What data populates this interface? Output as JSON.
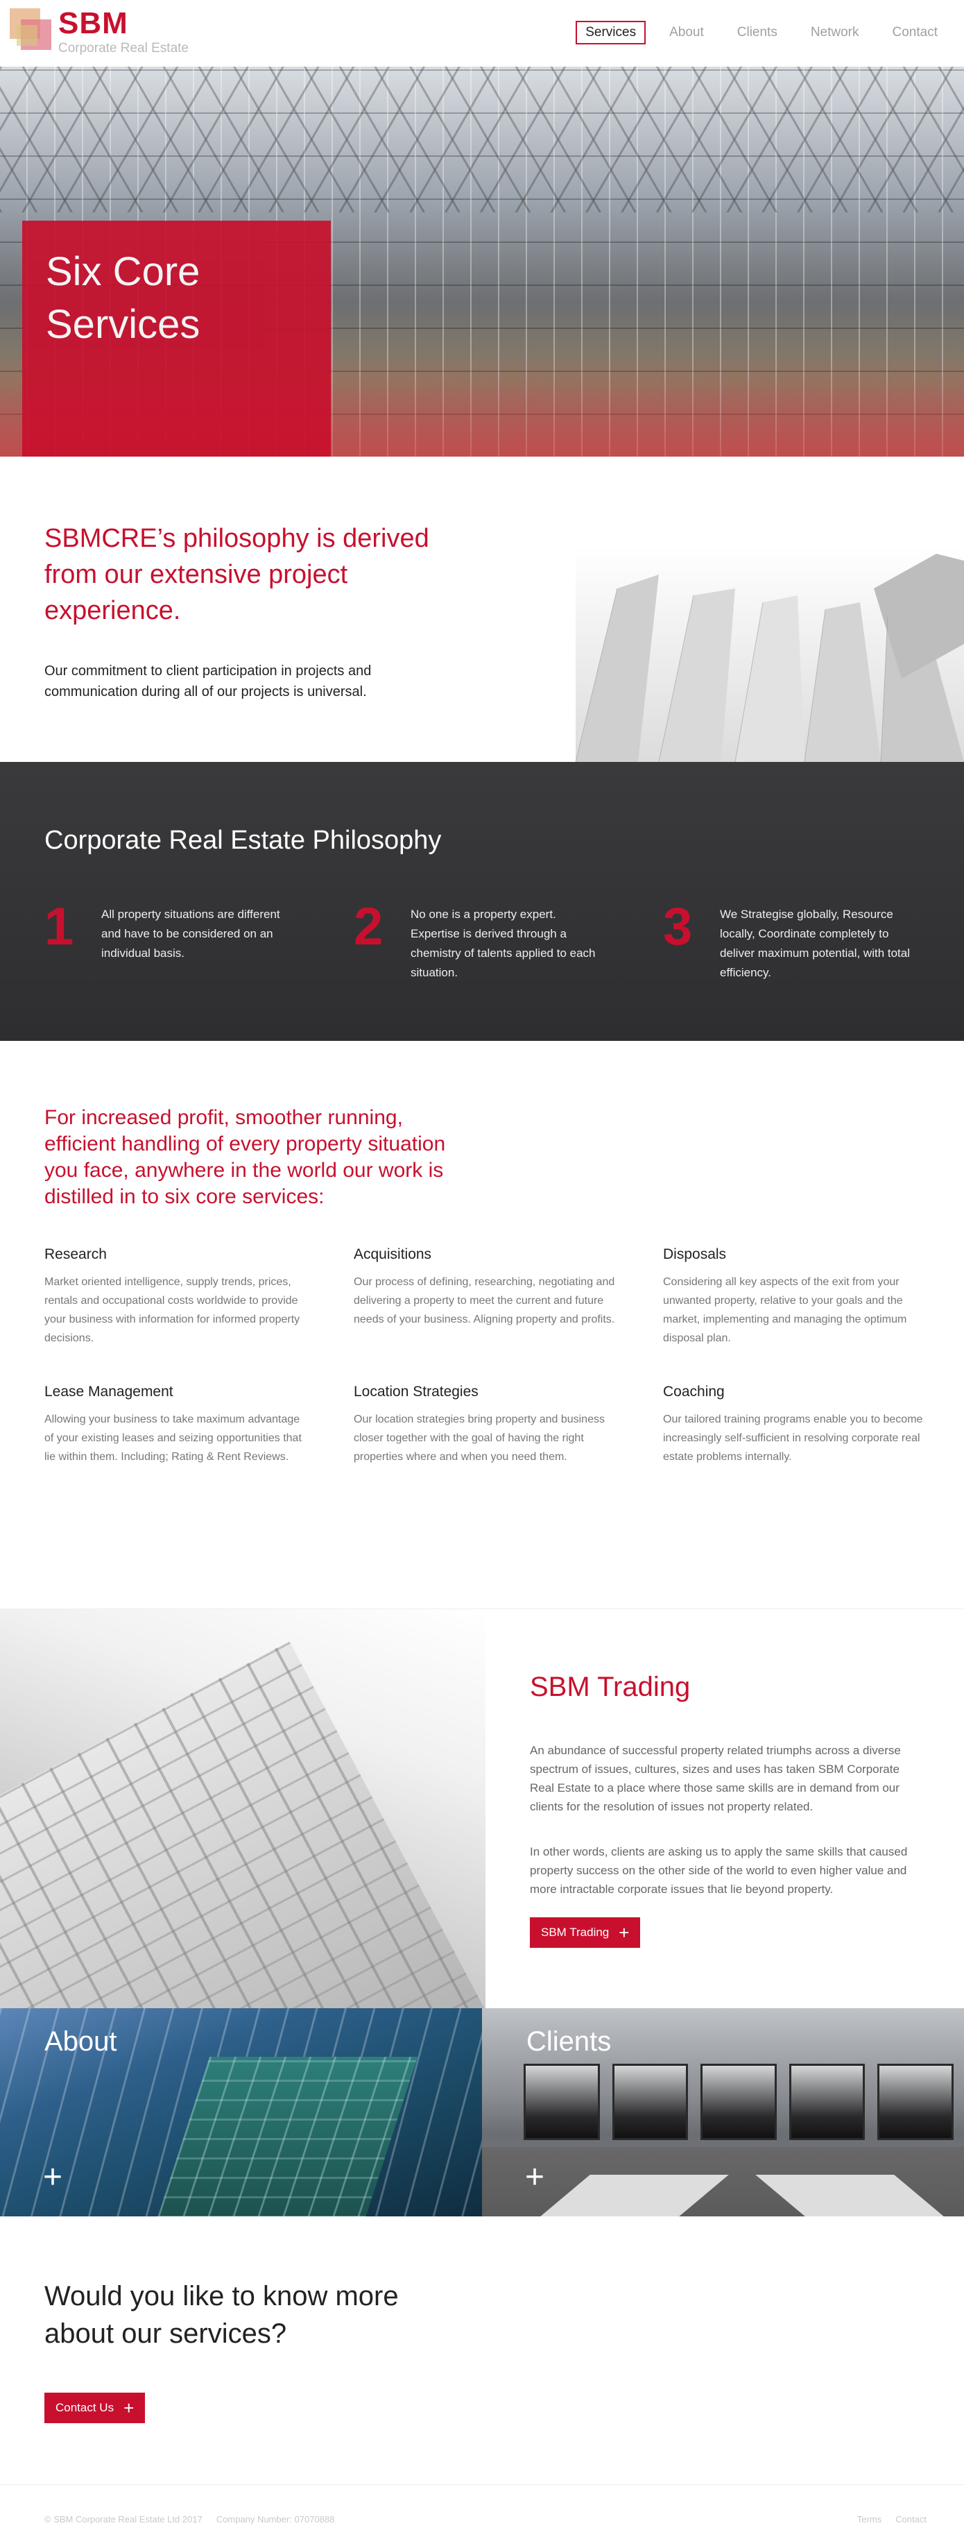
{
  "brand": {
    "name": "SBM",
    "tagline": "Corporate Real Estate"
  },
  "nav": [
    {
      "label": "Services",
      "active": true
    },
    {
      "label": "About",
      "active": false
    },
    {
      "label": "Clients",
      "active": false
    },
    {
      "label": "Network",
      "active": false
    },
    {
      "label": "Contact",
      "active": false
    }
  ],
  "hero": {
    "title": "Six Core Services"
  },
  "philosophy": {
    "heading": "SBMCRE’s philosophy is derived from our extensive project experience.",
    "text": "Our commitment to client participation in projects and communication during all of our projects is universal."
  },
  "corporate": {
    "title": "Corporate Real Estate Philosophy",
    "pillars": [
      {
        "num": "1",
        "text": "All property situations are different and have to be considered on an individual basis."
      },
      {
        "num": "2",
        "text": "No one is a property expert. Expertise is derived through a chemistry of talents applied to each situation."
      },
      {
        "num": "3",
        "text": "We Strategise globally, Resource locally, Coordinate completely to deliver maximum potential, with total efficiency."
      }
    ]
  },
  "six": {
    "heading": "For increased profit, smoother running, efficient handling of every property situation you face, anywhere in the world our work is distilled in to six core services:",
    "services": [
      {
        "title": "Research",
        "text": "Market oriented intelligence, supply trends, prices, rentals and occupational costs worldwide to provide your business with information for informed property decisions."
      },
      {
        "title": "Acquisitions",
        "text": "Our process of defining, researching, negotiating and delivering a property to meet the current and future needs of your business. Aligning property and profits."
      },
      {
        "title": "Disposals",
        "text": "Considering all key aspects of the exit from your unwanted property, relative to your goals and the market, implementing and managing the optimum disposal plan."
      },
      {
        "title": "Lease Management",
        "text": "Allowing your business to take maximum advantage of your existing leases and seizing opportunities that lie within them. Including; Rating & Rent Reviews."
      },
      {
        "title": "Location Strategies",
        "text": "Our location strategies bring property and business closer together with the goal of having the right properties where and when you need them."
      },
      {
        "title": "Coaching",
        "text": "Our tailored training programs enable you to become increasingly self-sufficient in resolving corporate real estate problems internally."
      }
    ]
  },
  "trading": {
    "title": "SBM Trading",
    "p1": "An abundance of successful property related triumphs across a diverse spectrum of issues, cultures, sizes and uses has taken SBM Corporate Real Estate to a place where those same skills are in demand from our clients for the resolution of issues not property related.",
    "p2": "In other words, clients are asking us to apply the same skills that caused property success on the other side of the world to even higher value and more intractable corporate issues that lie beyond property.",
    "button": "SBM Trading"
  },
  "tiles": [
    {
      "label": "About"
    },
    {
      "label": "Clients"
    }
  ],
  "cta": {
    "heading": "Would you like to know more about our services?",
    "button": "Contact Us"
  },
  "footer": {
    "copyright": "© SBM Corporate Real Estate Ltd 2017",
    "company": "Company Number: 07070888",
    "links": [
      "Terms",
      "Contact"
    ]
  },
  "colors": {
    "accent": "#c8102e",
    "dark": "#333335"
  },
  "icons": {
    "plus": "+"
  }
}
